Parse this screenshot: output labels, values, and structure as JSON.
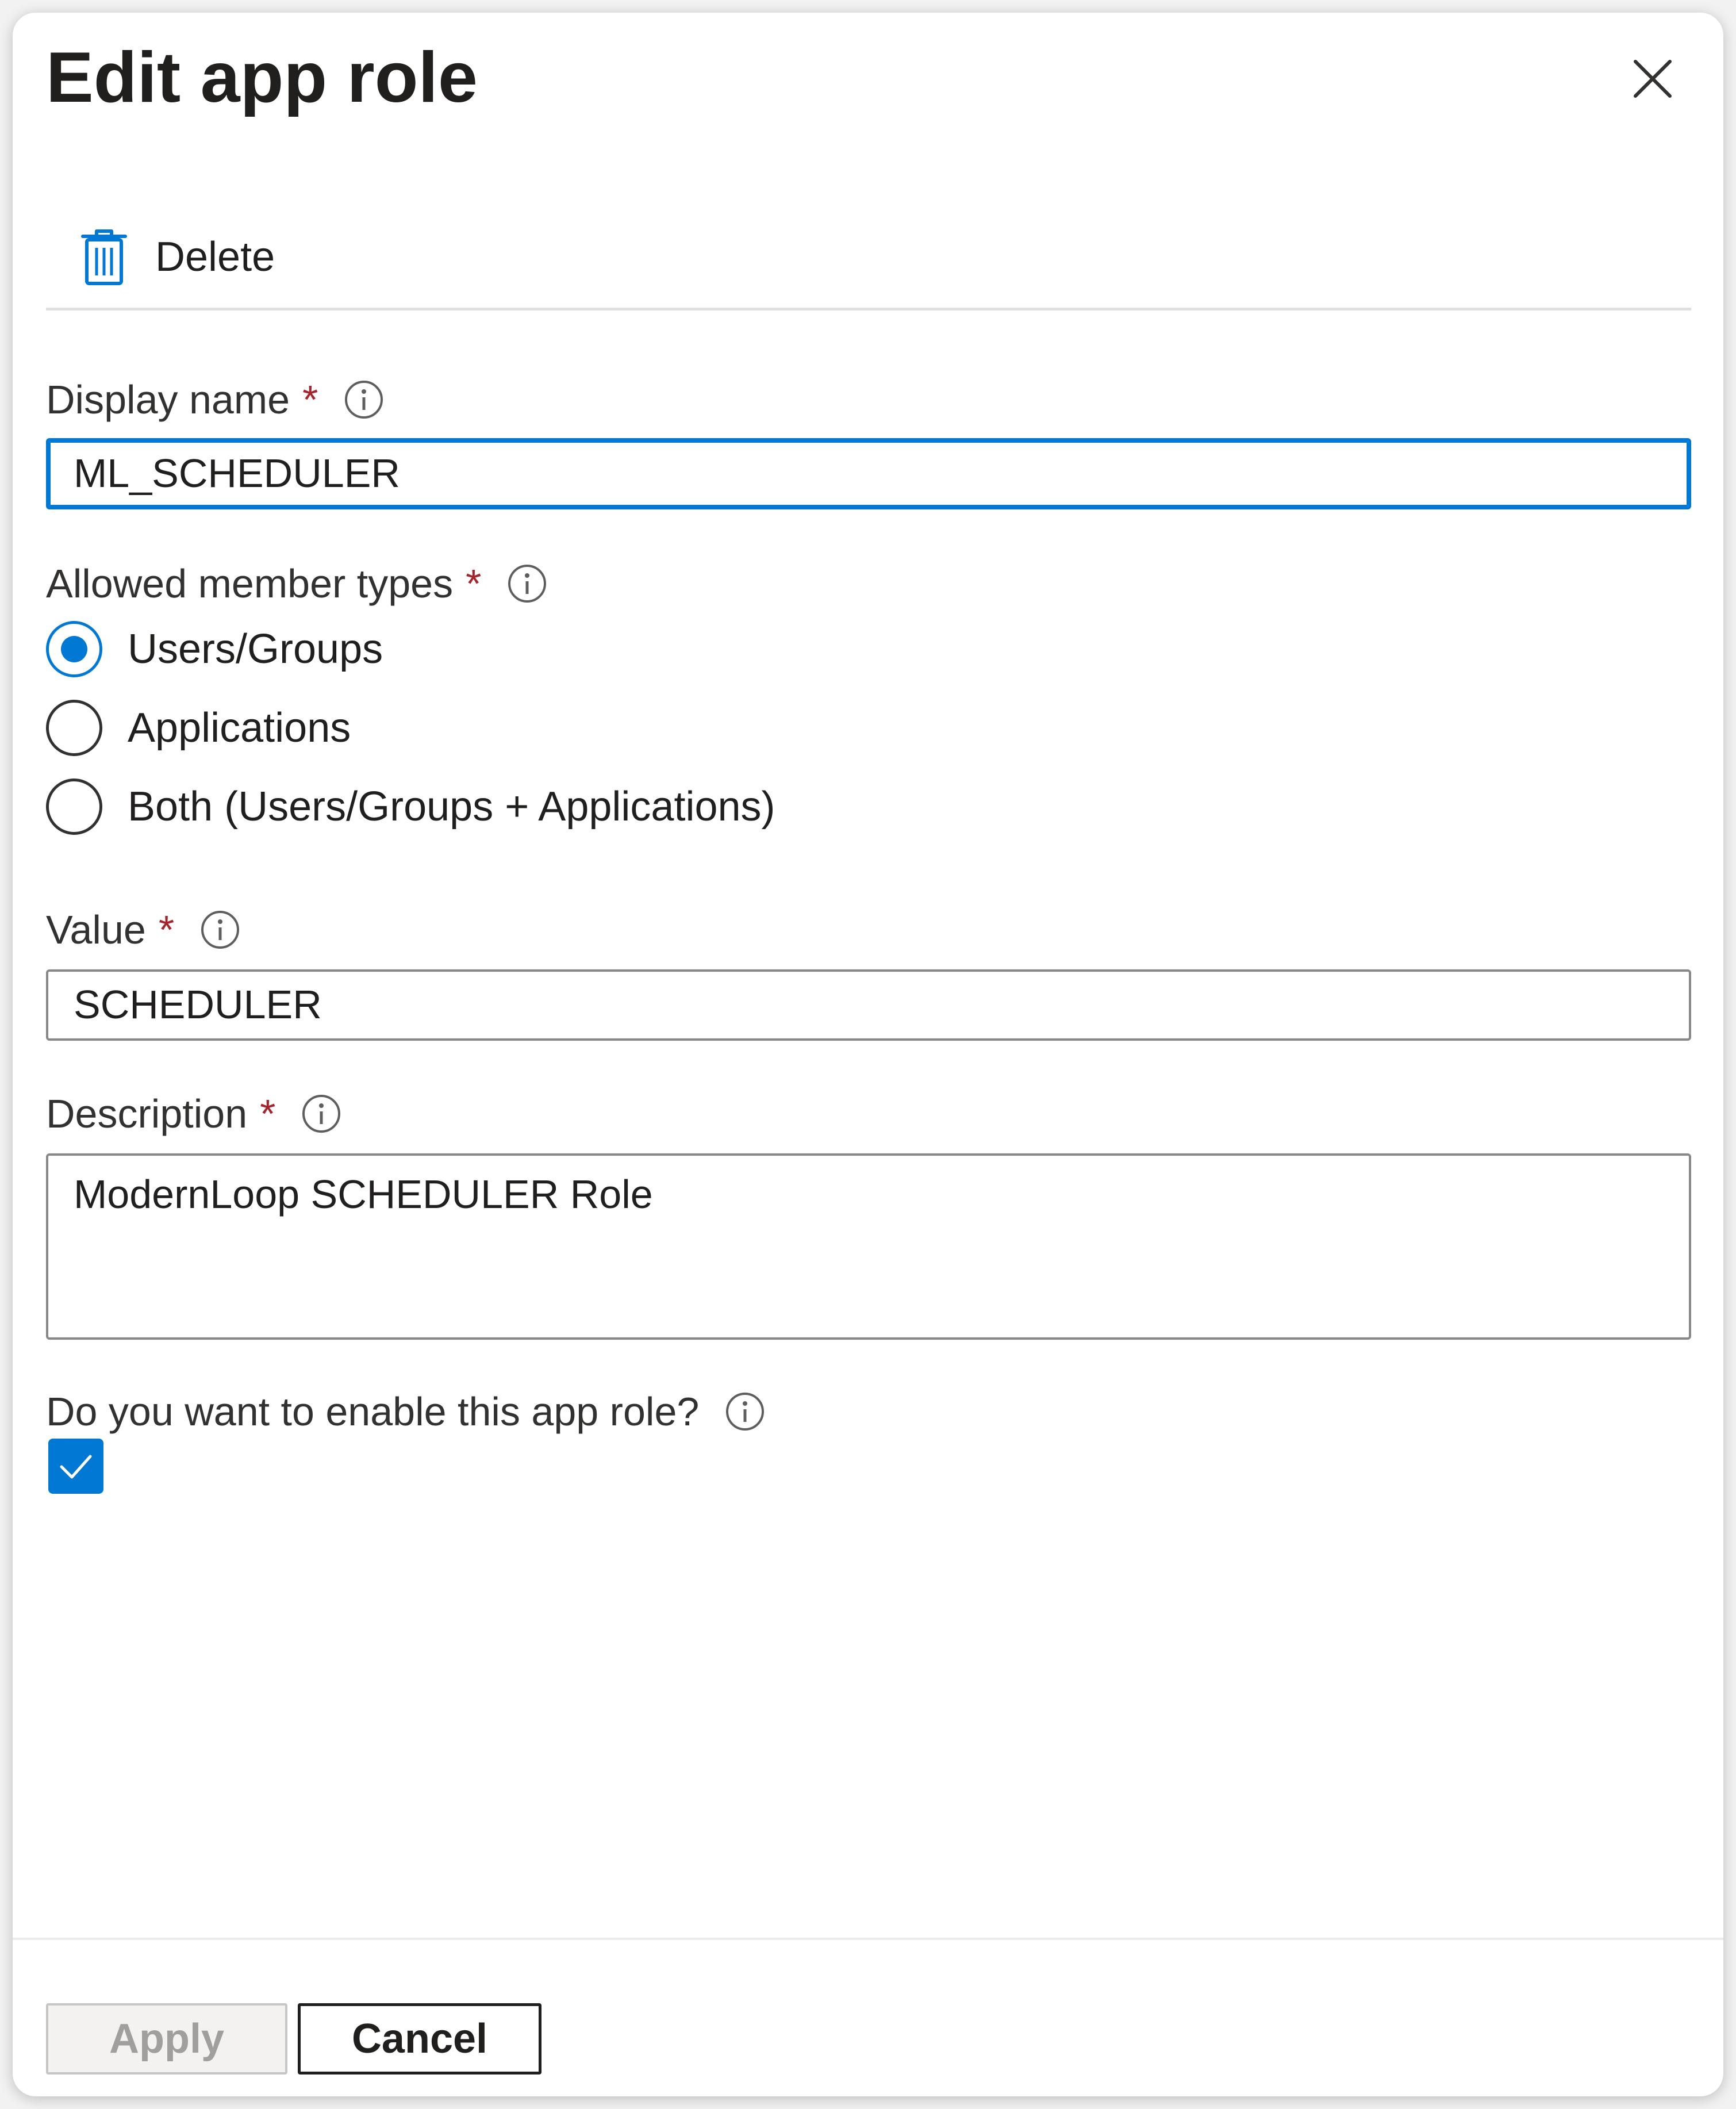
{
  "panel": {
    "title": "Edit app role",
    "close_icon": "close-icon"
  },
  "toolbar": {
    "delete_label": "Delete",
    "delete_icon": "trash-icon"
  },
  "form": {
    "display_name": {
      "label": "Display name",
      "required_mark": "*",
      "value": "ML_SCHEDULER",
      "focused": true
    },
    "member_types": {
      "label": "Allowed member types",
      "required_mark": "*",
      "options": [
        {
          "label": "Users/Groups",
          "selected": true
        },
        {
          "label": "Applications",
          "selected": false
        },
        {
          "label": "Both (Users/Groups + Applications)",
          "selected": false
        }
      ]
    },
    "value": {
      "label": "Value",
      "required_mark": "*",
      "value": "SCHEDULER"
    },
    "description": {
      "label": "Description",
      "required_mark": "*",
      "value": "ModernLoop SCHEDULER Role"
    },
    "enable": {
      "label": "Do you want to enable this app role?",
      "checked": true
    }
  },
  "footer": {
    "apply_label": "Apply",
    "apply_disabled": true,
    "cancel_label": "Cancel"
  },
  "colors": {
    "accent": "#0078d4",
    "required": "#a4262c",
    "border": "#8a8886"
  }
}
